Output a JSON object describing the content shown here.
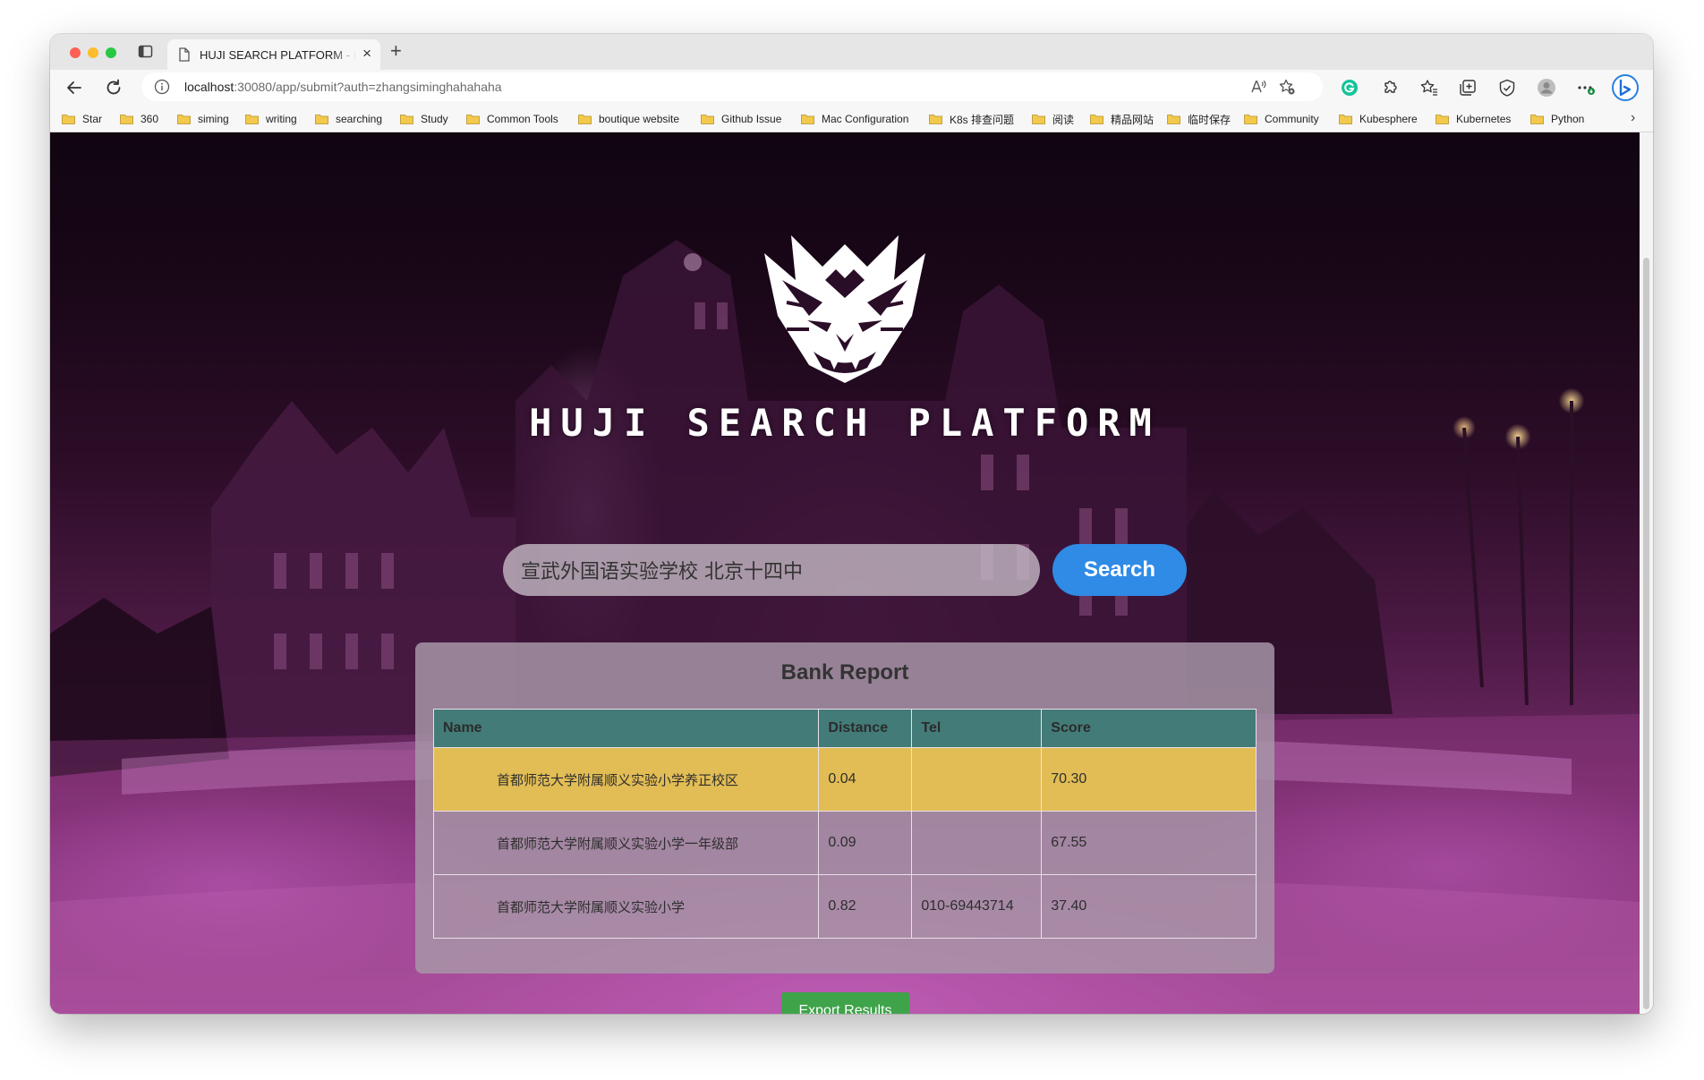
{
  "browser": {
    "tab_title": "HUJI SEARCH PLATFORM - Re",
    "tab_close": "×",
    "new_tab": "+",
    "url_host": "localhost",
    "url_rest": ":30080/app/submit?auth=zhangsiminghahahaha",
    "bookmarks": [
      "Star",
      "360",
      "siming",
      "writing",
      "searching",
      "Study",
      "Common Tools",
      "boutique website",
      "Github Issue",
      "Mac Configuration",
      "K8s 排查问题",
      "阅读",
      "精品网站",
      "临时保存",
      "Community",
      "Kubesphere",
      "Kubernetes",
      "Python"
    ],
    "bookmarks_more": "›"
  },
  "page": {
    "brand": "HUJI SEARCH PLATFORM",
    "search": {
      "value": "宣武外国语实验学校 北京十四中",
      "button_label": "Search"
    },
    "report": {
      "title": "Bank Report",
      "columns": [
        "Name",
        "Distance",
        "Tel",
        "Score"
      ],
      "rows": [
        {
          "name": "首都师范大学附属顺义实验小学养正校区",
          "distance": "0.04",
          "tel": "",
          "score": "70.30",
          "highlighted": true
        },
        {
          "name": "首都师范大学附属顺义实验小学一年级部",
          "distance": "0.09",
          "tel": "",
          "score": "67.55",
          "highlighted": false
        },
        {
          "name": "首都师范大学附属顺义实验小学",
          "distance": "0.82",
          "tel": "010-69443714",
          "score": "37.40",
          "highlighted": false
        }
      ]
    },
    "export_label": "Export Results"
  },
  "colors": {
    "search_button": "#2f8be6",
    "table_header": "#437b78",
    "highlight_row": "#e2bd55",
    "export_button": "#3fa34a"
  }
}
